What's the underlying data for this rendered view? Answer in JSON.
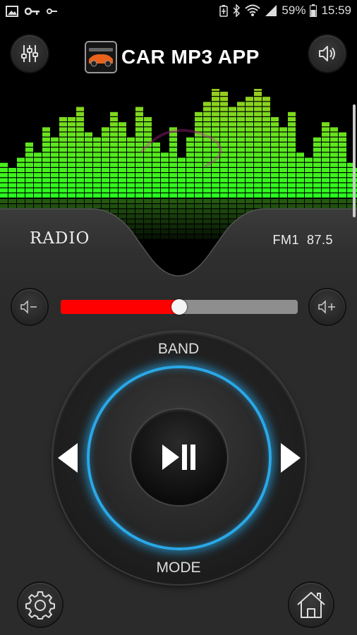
{
  "status_bar": {
    "battery_percent": "59%",
    "time": "15:59",
    "icons": [
      "image-icon",
      "key-icon",
      "key-small-icon",
      "battery-saver-icon",
      "bluetooth-icon",
      "wifi-icon",
      "signal-icon",
      "battery-icon"
    ]
  },
  "header": {
    "title": "CAR MP3 APP",
    "left_icon": "equalizer-icon",
    "right_icon": "speaker-icon"
  },
  "display": {
    "source_label": "RADIO",
    "frequency": "FM1  87.5"
  },
  "volume": {
    "level": 0.5,
    "down_icon": "volume-down-icon",
    "up_icon": "volume-up-icon",
    "fill_color": "#ff0000"
  },
  "dial": {
    "band_label": "BAND",
    "mode_label": "MODE",
    "center_icon": "play-pause-icon",
    "accent": "#2aa8e8"
  },
  "bottom": {
    "left_icon": "settings-gear-icon",
    "right_icon": "home-icon"
  }
}
